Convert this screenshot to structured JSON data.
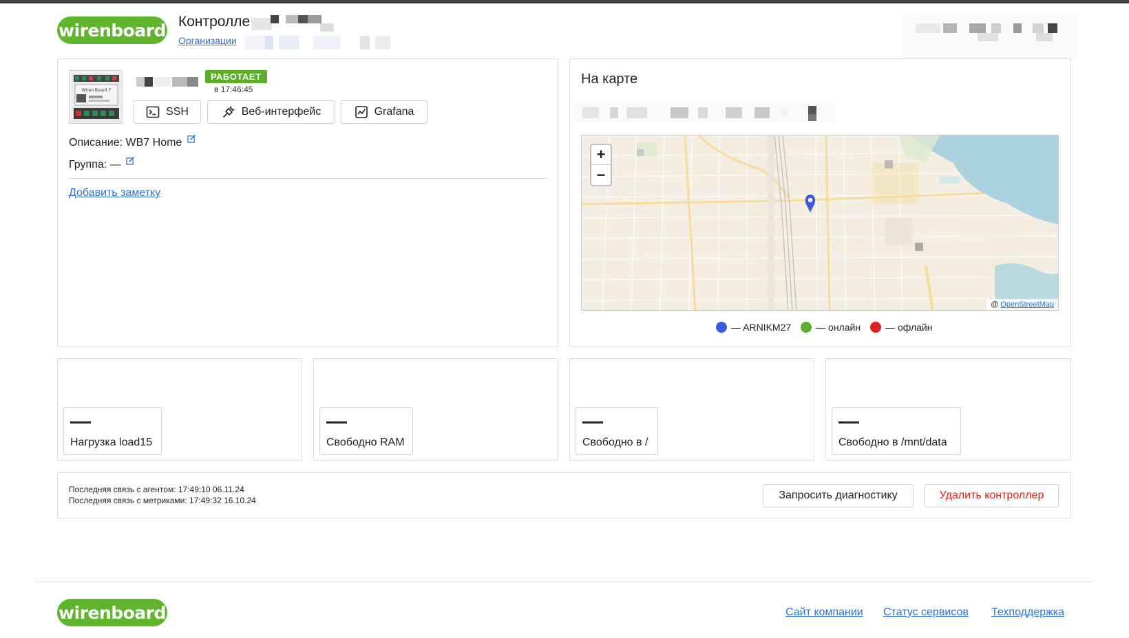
{
  "header": {
    "logo_text": "wirenboard",
    "title": "Контролле",
    "breadcrumb": "Организации"
  },
  "device": {
    "status": "РАБОТАЕТ",
    "status_time": "в 17:46:45",
    "image_caption": "Wiren Board 7",
    "actions": {
      "ssh": "SSH",
      "web": "Веб-интерфейс",
      "grafana": "Grafana"
    },
    "description_label": "Описание:",
    "description_value": "WB7 Home",
    "group_label": "Группа:",
    "group_value": "—",
    "add_note": "Добавить заметку"
  },
  "map": {
    "title": "На карте",
    "zoom_in": "+",
    "zoom_out": "−",
    "attribution_prefix": "@",
    "attribution_link": "OpenStreetMap",
    "legend": [
      {
        "color": "#3b5bdb",
        "label": "— ARNIKM27"
      },
      {
        "color": "#5aae28",
        "label": "— онлайн"
      },
      {
        "color": "#e02020",
        "label": "— офлайн"
      }
    ]
  },
  "metrics": [
    {
      "value": "—",
      "label": "Нагрузка load15"
    },
    {
      "value": "—",
      "label": "Свободно RAM"
    },
    {
      "value": "—",
      "label": "Свободно в /"
    },
    {
      "value": "—",
      "label": "Свободно в /mnt/data"
    }
  ],
  "connection": {
    "agent": "Последняя связь с агентом: 17:49:10 06.11.24",
    "metrics": "Последняя связь с метриками: 17:49:32 16.10.24",
    "diagnostics_button": "Запросить диагностику",
    "delete_button": "Удалить контроллер"
  },
  "footer": {
    "logo_text": "wirenboard",
    "links": [
      "Сайт компании",
      "Статус сервисов",
      "Техподдержка"
    ]
  },
  "colors": {
    "brand_green": "#5fb52b",
    "link_blue": "#2a6fdb",
    "danger_red": "#e02020"
  }
}
